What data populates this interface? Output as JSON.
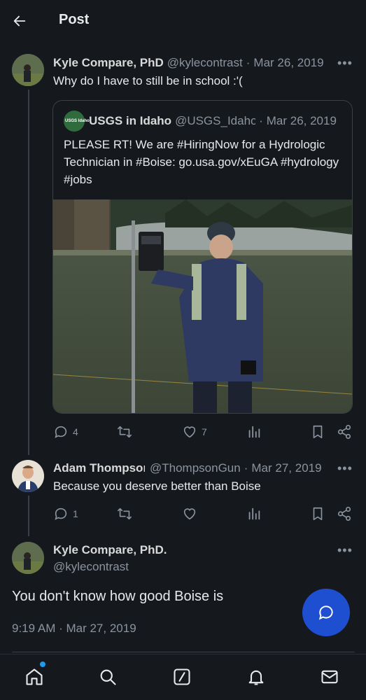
{
  "header": {
    "title": "Post"
  },
  "tweets": [
    {
      "name": "Kyle Compare, PhD",
      "handle": "@kylecontrast",
      "date": "Mar 26, 2019",
      "text": "Why do I have to still be in school :'(",
      "actions": {
        "replies": "4",
        "retweets": "",
        "likes": "7"
      }
    },
    {
      "name": "Adam Thompson",
      "handle": "@ThompsonGun",
      "date": "Mar 27, 2019",
      "text": "Because you deserve better than Boise",
      "actions": {
        "replies": "1",
        "retweets": "",
        "likes": ""
      }
    }
  ],
  "quote": {
    "logo_text": "USGS Idaho",
    "name": "USGS in Idaho",
    "handle": "@USGS_Idaho",
    "date": "Mar 26, 2019",
    "text": "PLEASE RT! We are #HiringNow for a Hydrologic Technician in #Boise: go.usa.gov/xEuGA #hydrology #jobs"
  },
  "main_post": {
    "name": "Kyle Compare, PhD.",
    "handle": "@kylecontrast",
    "text": "You don't know how good Boise is",
    "timestamp": "9:19 AM · Mar 27, 2019"
  },
  "separator": "·",
  "more_label": "•••",
  "icons": [
    "back-arrow-icon",
    "reply-icon",
    "retweet-icon",
    "like-icon",
    "views-icon",
    "bookmark-icon",
    "share-icon",
    "compose-reply-icon",
    "home-icon",
    "search-icon",
    "grok-icon",
    "notifications-icon",
    "messages-icon"
  ],
  "colors": {
    "background": "#15181d",
    "accent": "#1d4fd0",
    "muted": "#8b949e"
  }
}
